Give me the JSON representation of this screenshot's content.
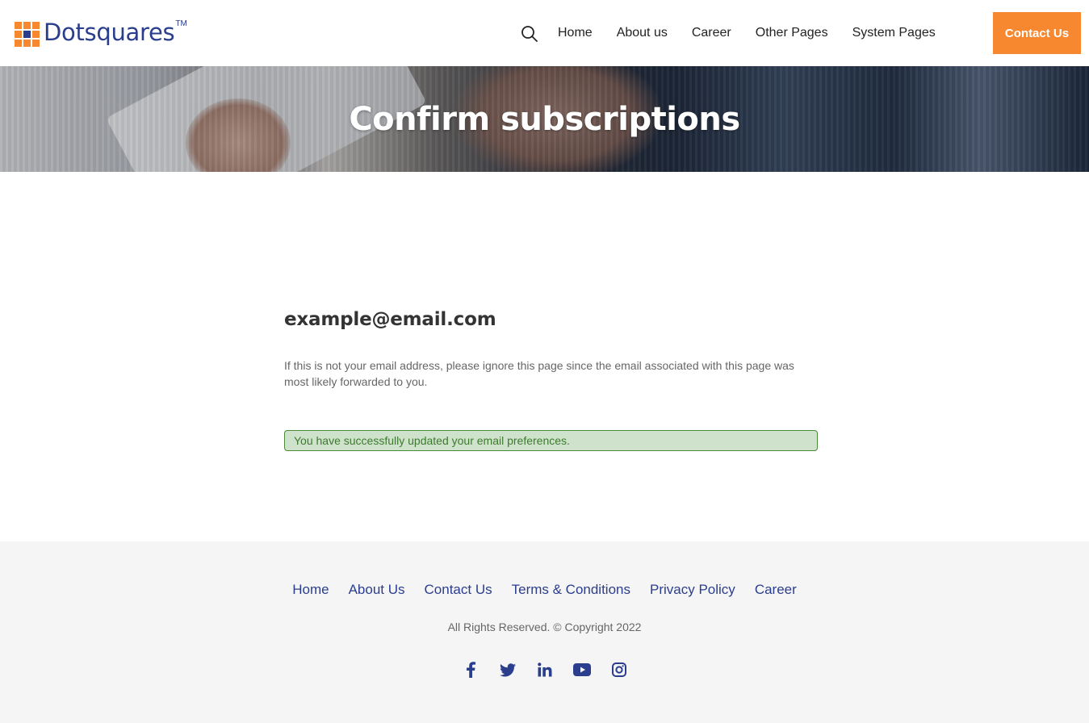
{
  "header": {
    "logo_text": "Dotsquares",
    "logo_tm": "TM",
    "search_icon": "search-icon",
    "nav": [
      {
        "label": "Home"
      },
      {
        "label": "About us"
      },
      {
        "label": "Career"
      },
      {
        "label": "Other Pages"
      },
      {
        "label": "System Pages"
      }
    ],
    "contact_label": "Contact Us"
  },
  "hero": {
    "title": "Confirm subscriptions"
  },
  "main": {
    "email": "example@email.com",
    "note": "If this is not your email address, please ignore this page since the email associated with this page was most likely forwarded to you.",
    "alert": "You have successfully updated your email preferences."
  },
  "footer": {
    "links": [
      {
        "label": "Home"
      },
      {
        "label": "About Us"
      },
      {
        "label": "Contact Us"
      },
      {
        "label": "Terms & Conditions"
      },
      {
        "label": "Privacy Policy"
      },
      {
        "label": "Career"
      }
    ],
    "copyright": "All Rights Reserved. © Copyright 2022",
    "social": [
      "facebook-icon",
      "twitter-icon",
      "linkedin-icon",
      "youtube-icon",
      "instagram-icon"
    ]
  },
  "colors": {
    "brand_blue": "#2b3e8e",
    "accent_orange": "#f7882f",
    "success_bg": "#cfe3cc",
    "success_text": "#3c7a2d",
    "footer_bg": "#f5f5f5"
  }
}
